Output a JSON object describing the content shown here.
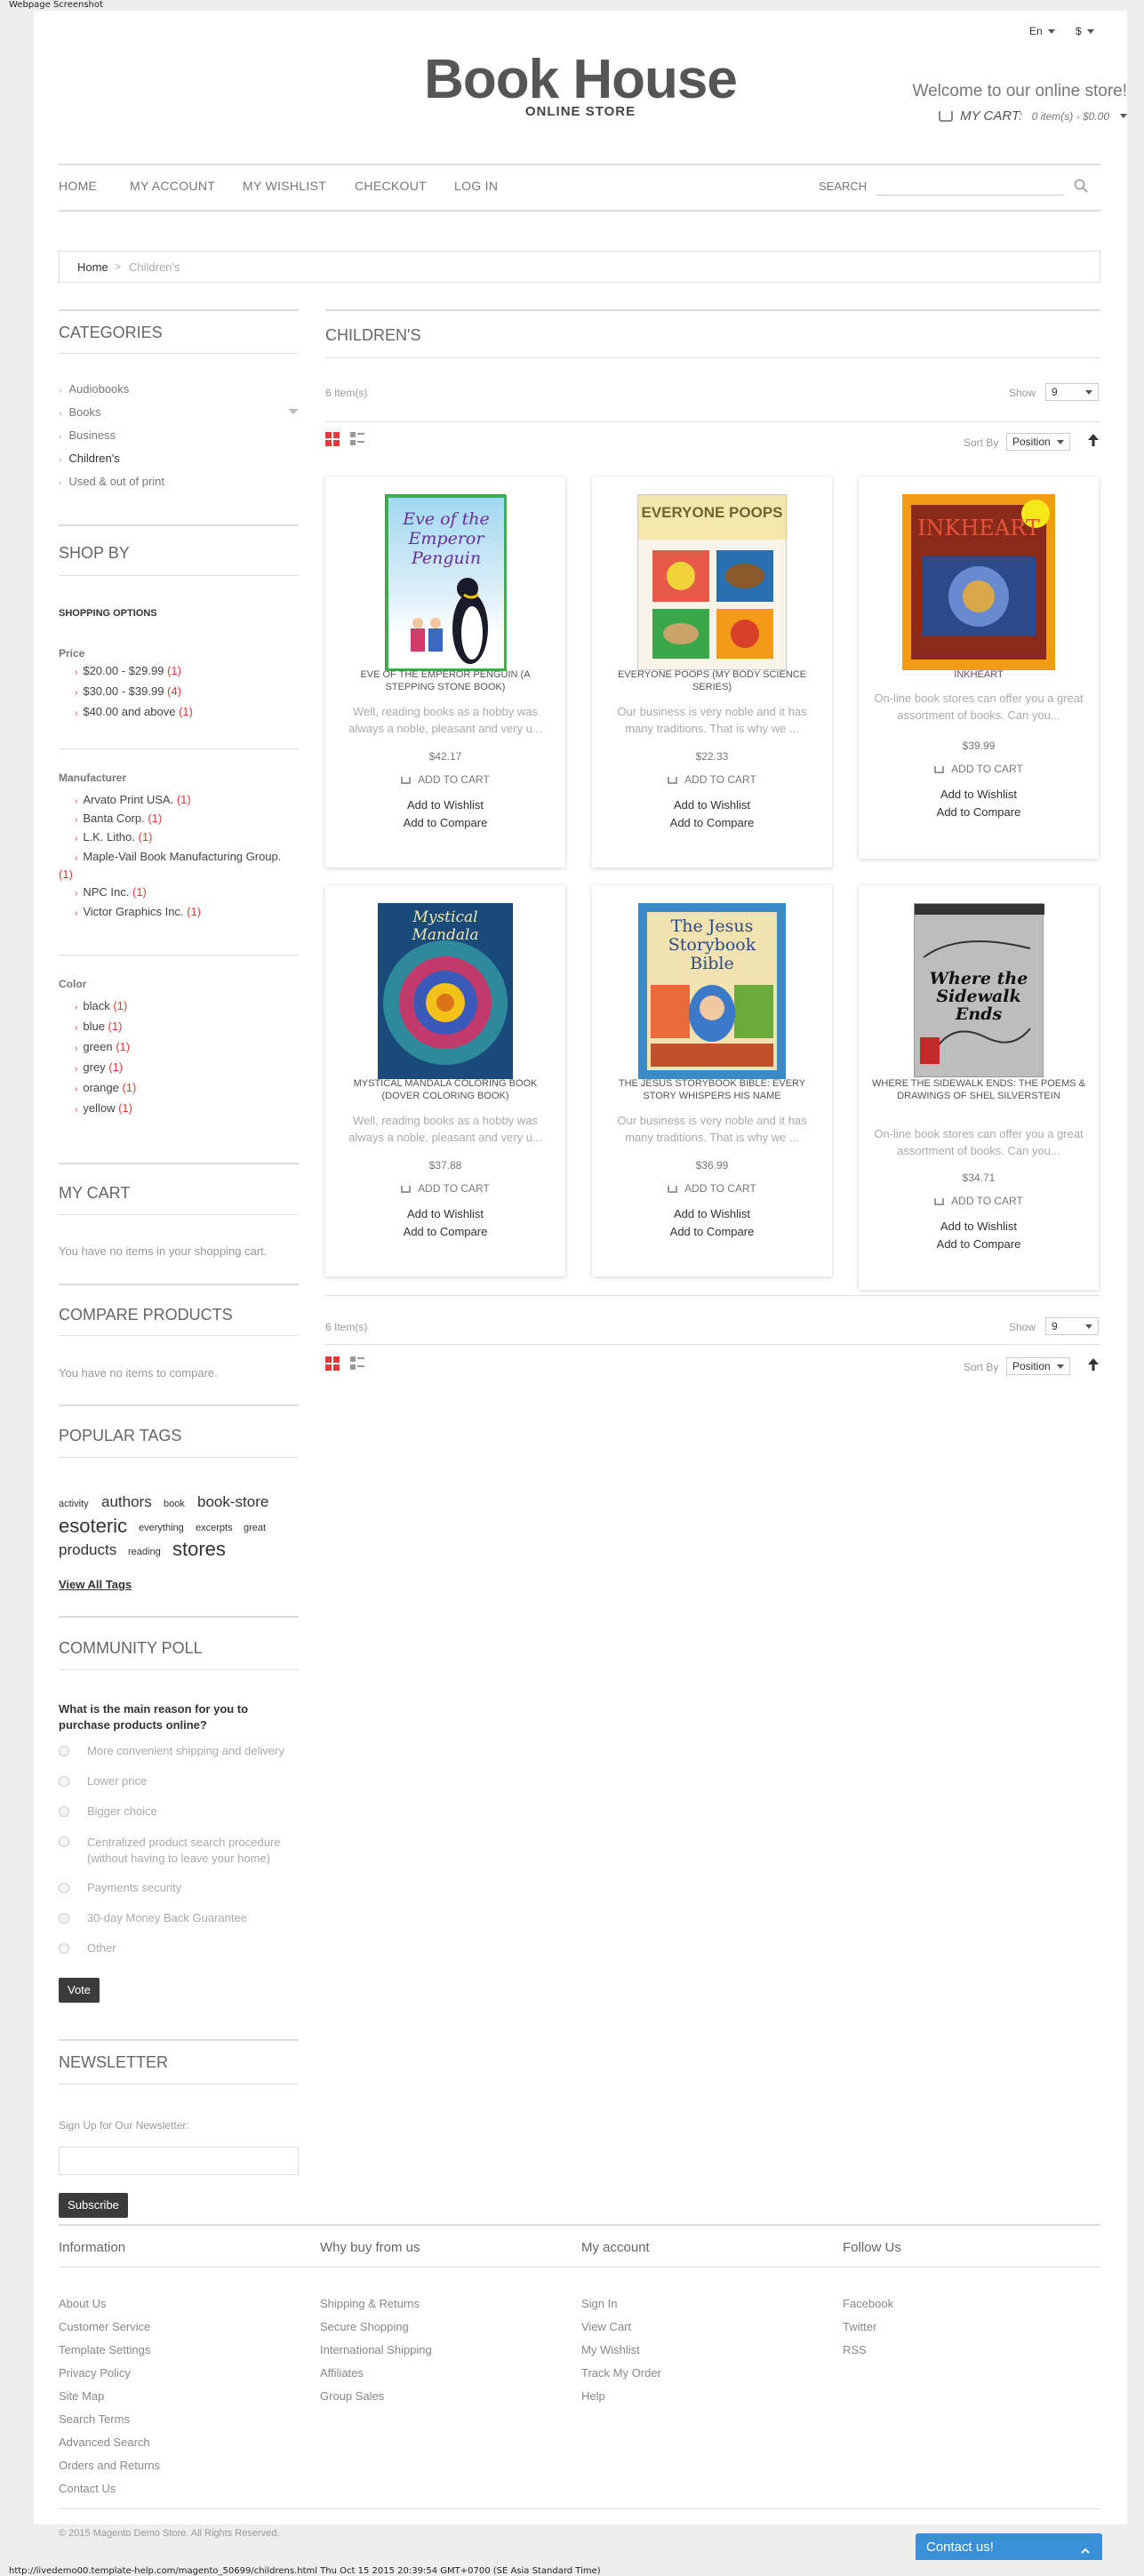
{
  "screenshot_title": "Webpage Screenshot",
  "header": {
    "lang": "En",
    "currency": "$",
    "logo": "Book House",
    "logo_sub": "ONLINE STORE",
    "welcome": "Welcome to our online store!",
    "cart_label": "MY CART:",
    "cart_summary": "0 item(s) - $0.00"
  },
  "nav": {
    "items": [
      "HOME",
      "MY ACCOUNT",
      "MY WISHLIST",
      "CHECKOUT",
      "LOG IN"
    ],
    "search_label": "SEARCH"
  },
  "breadcrumb": {
    "home": "Home",
    "sep": ">",
    "current": "Children's"
  },
  "sidebar": {
    "categories_title": "CATEGORIES",
    "categories": [
      "Audiobooks",
      "Books",
      "Business",
      "Children's",
      "Used & out of print"
    ],
    "shopby_title": "SHOP BY",
    "shopping_options": "SHOPPING OPTIONS",
    "price_title": "Price",
    "prices": [
      {
        "label": "$20.00 - $29.99",
        "count": "(1)"
      },
      {
        "label": "$30.00 - $39.99",
        "count": "(4)"
      },
      {
        "label": "$40.00 and above",
        "count": "(1)"
      }
    ],
    "manufacturer_title": "Manufacturer",
    "manufacturers": [
      {
        "label": "Arvato Print USA.",
        "count": "(1)"
      },
      {
        "label": "Banta Corp.",
        "count": "(1)"
      },
      {
        "label": "L.K. Litho.",
        "count": "(1)"
      },
      {
        "label": "Maple-Vail Book Manufacturing Group.",
        "count": "(1)"
      },
      {
        "label": "NPC Inc.",
        "count": "(1)"
      },
      {
        "label": "Victor Graphics Inc.",
        "count": "(1)"
      }
    ],
    "color_title": "Color",
    "colors": [
      {
        "label": "black",
        "count": "(1)"
      },
      {
        "label": "blue",
        "count": "(1)"
      },
      {
        "label": "green",
        "count": "(1)"
      },
      {
        "label": "grey",
        "count": "(1)"
      },
      {
        "label": "orange",
        "count": "(1)"
      },
      {
        "label": "yellow",
        "count": "(1)"
      }
    ],
    "mycart_title": "MY CART",
    "mycart_text": "You have no items in your shopping cart.",
    "compare_title": "COMPARE PRODUCTS",
    "compare_text": "You have no items to compare.",
    "tags_title": "POPULAR TAGS",
    "tags": [
      "activity",
      "authors",
      "book",
      "book-store",
      "esoteric",
      "everything",
      "excerpts",
      "great",
      "products",
      "reading",
      "stores"
    ],
    "view_all_tags": "View All Tags",
    "poll_title": "COMMUNITY POLL",
    "poll_question": "What is the main reason for you to purchase products online?",
    "poll_options": [
      "More convenient shipping and delivery",
      "Lower price",
      "Bigger choice",
      "Centralized product search procedure (without having to leave your home)",
      "Payments security",
      "30-day Money Back Guarantee",
      "Other"
    ],
    "vote": "Vote",
    "newsletter_title": "NEWSLETTER",
    "newsletter_label": "Sign Up for Our Newsletter:",
    "subscribe": "Subscribe"
  },
  "main": {
    "title": "CHILDREN'S",
    "items_count": "6 Item(s)",
    "show_label": "Show",
    "show_value": "9",
    "sortby_label": "Sort By",
    "sortby_value": "Position",
    "add_to_cart": "ADD TO CART",
    "add_to_wishlist": "Add to Wishlist",
    "add_to_compare": "Add to Compare",
    "products": [
      {
        "name": "EVE OF THE EMPEROR PENGUIN (A STEPPING STONE BOOK)",
        "desc": "Well, reading books as a hobby was always a noble, pleasant and very u...",
        "price": "$42.17",
        "cover": "Eve of the Emperor Penguin"
      },
      {
        "name": "EVERYONE POOPS (MY BODY SCIENCE SERIES)",
        "desc": "Our business is very noble and it has many traditions. That is why we ...",
        "price": "$22.33",
        "cover": "EVERYONE POOPS"
      },
      {
        "name": "INKHEART",
        "desc": "On-line book stores can offer you a great assortment of books. Can you...",
        "price": "$39.99",
        "cover": "INKHEART"
      },
      {
        "name": "MYSTICAL MANDALA COLORING BOOK (DOVER COLORING BOOK)",
        "desc": "Well, reading books as a hobby was always a noble, pleasant and very u...",
        "price": "$37.88",
        "cover": "Mystical Mandala"
      },
      {
        "name": "THE JESUS STORYBOOK BIBLE: EVERY STORY WHISPERS HIS NAME",
        "desc": "Our business is very noble and it has many traditions. That is why we ...",
        "price": "$36.99",
        "cover": "The Jesus Storybook Bible"
      },
      {
        "name": "WHERE THE SIDEWALK ENDS: THE POEMS & DRAWINGS OF SHEL SILVERSTEIN",
        "desc": "On-line book stores can offer you a great assortment of books. Can you...",
        "price": "$34.71",
        "cover": "Where the Sidewalk Ends"
      }
    ]
  },
  "footer": {
    "columns": [
      {
        "title": "Information",
        "links": [
          "About Us",
          "Customer Service",
          "Template Settings",
          "Privacy Policy",
          "Site Map",
          "Search Terms",
          "Advanced Search",
          "Orders and Returns",
          "Contact Us"
        ]
      },
      {
        "title": "Why buy from us",
        "links": [
          "Shipping & Returns",
          "Secure Shopping",
          "International Shipping",
          "Affiliates",
          "Group Sales"
        ]
      },
      {
        "title": "My account",
        "links": [
          "Sign In",
          "View Cart",
          "My Wishlist",
          "Track My Order",
          "Help"
        ]
      },
      {
        "title": "Follow Us",
        "links": [
          "Facebook",
          "Twitter",
          "RSS"
        ]
      }
    ],
    "copyright": "© 2015 Magento Demo Store. All Rights Reserved."
  },
  "contact_us": "Contact us!",
  "status_url": "http://livedemo00.template-help.com/magento_50699/childrens.html  Thu Oct 15 2015 20:39:54 GMT+0700 (SE Asia Standard Time)"
}
